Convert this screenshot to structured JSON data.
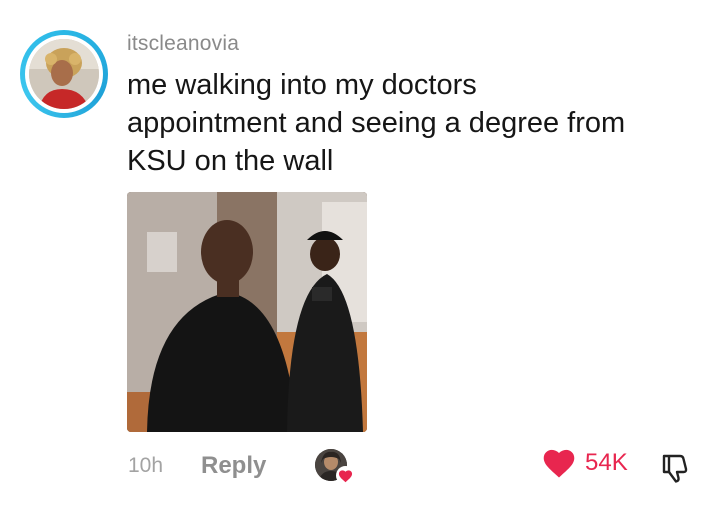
{
  "comment": {
    "username": "itscleanovia",
    "text_lines": [
      "me walking into my doctors",
      "appointment and seeing a degree from",
      "KSU on the wall"
    ],
    "media": {
      "description_icon": "video-thumbnail"
    }
  },
  "footer": {
    "time": "10h",
    "reply_label": "Reply",
    "like_count": "54K",
    "icons": {
      "like": "heart-icon",
      "dislike": "thumbs-down-icon",
      "creator_liked": "creator-liked-badge-icon"
    }
  },
  "colors": {
    "avatar_ring": "#2bb8e6",
    "like": "#e8264f",
    "username": "#8a8a8a",
    "meta": "#a3a3a3"
  }
}
